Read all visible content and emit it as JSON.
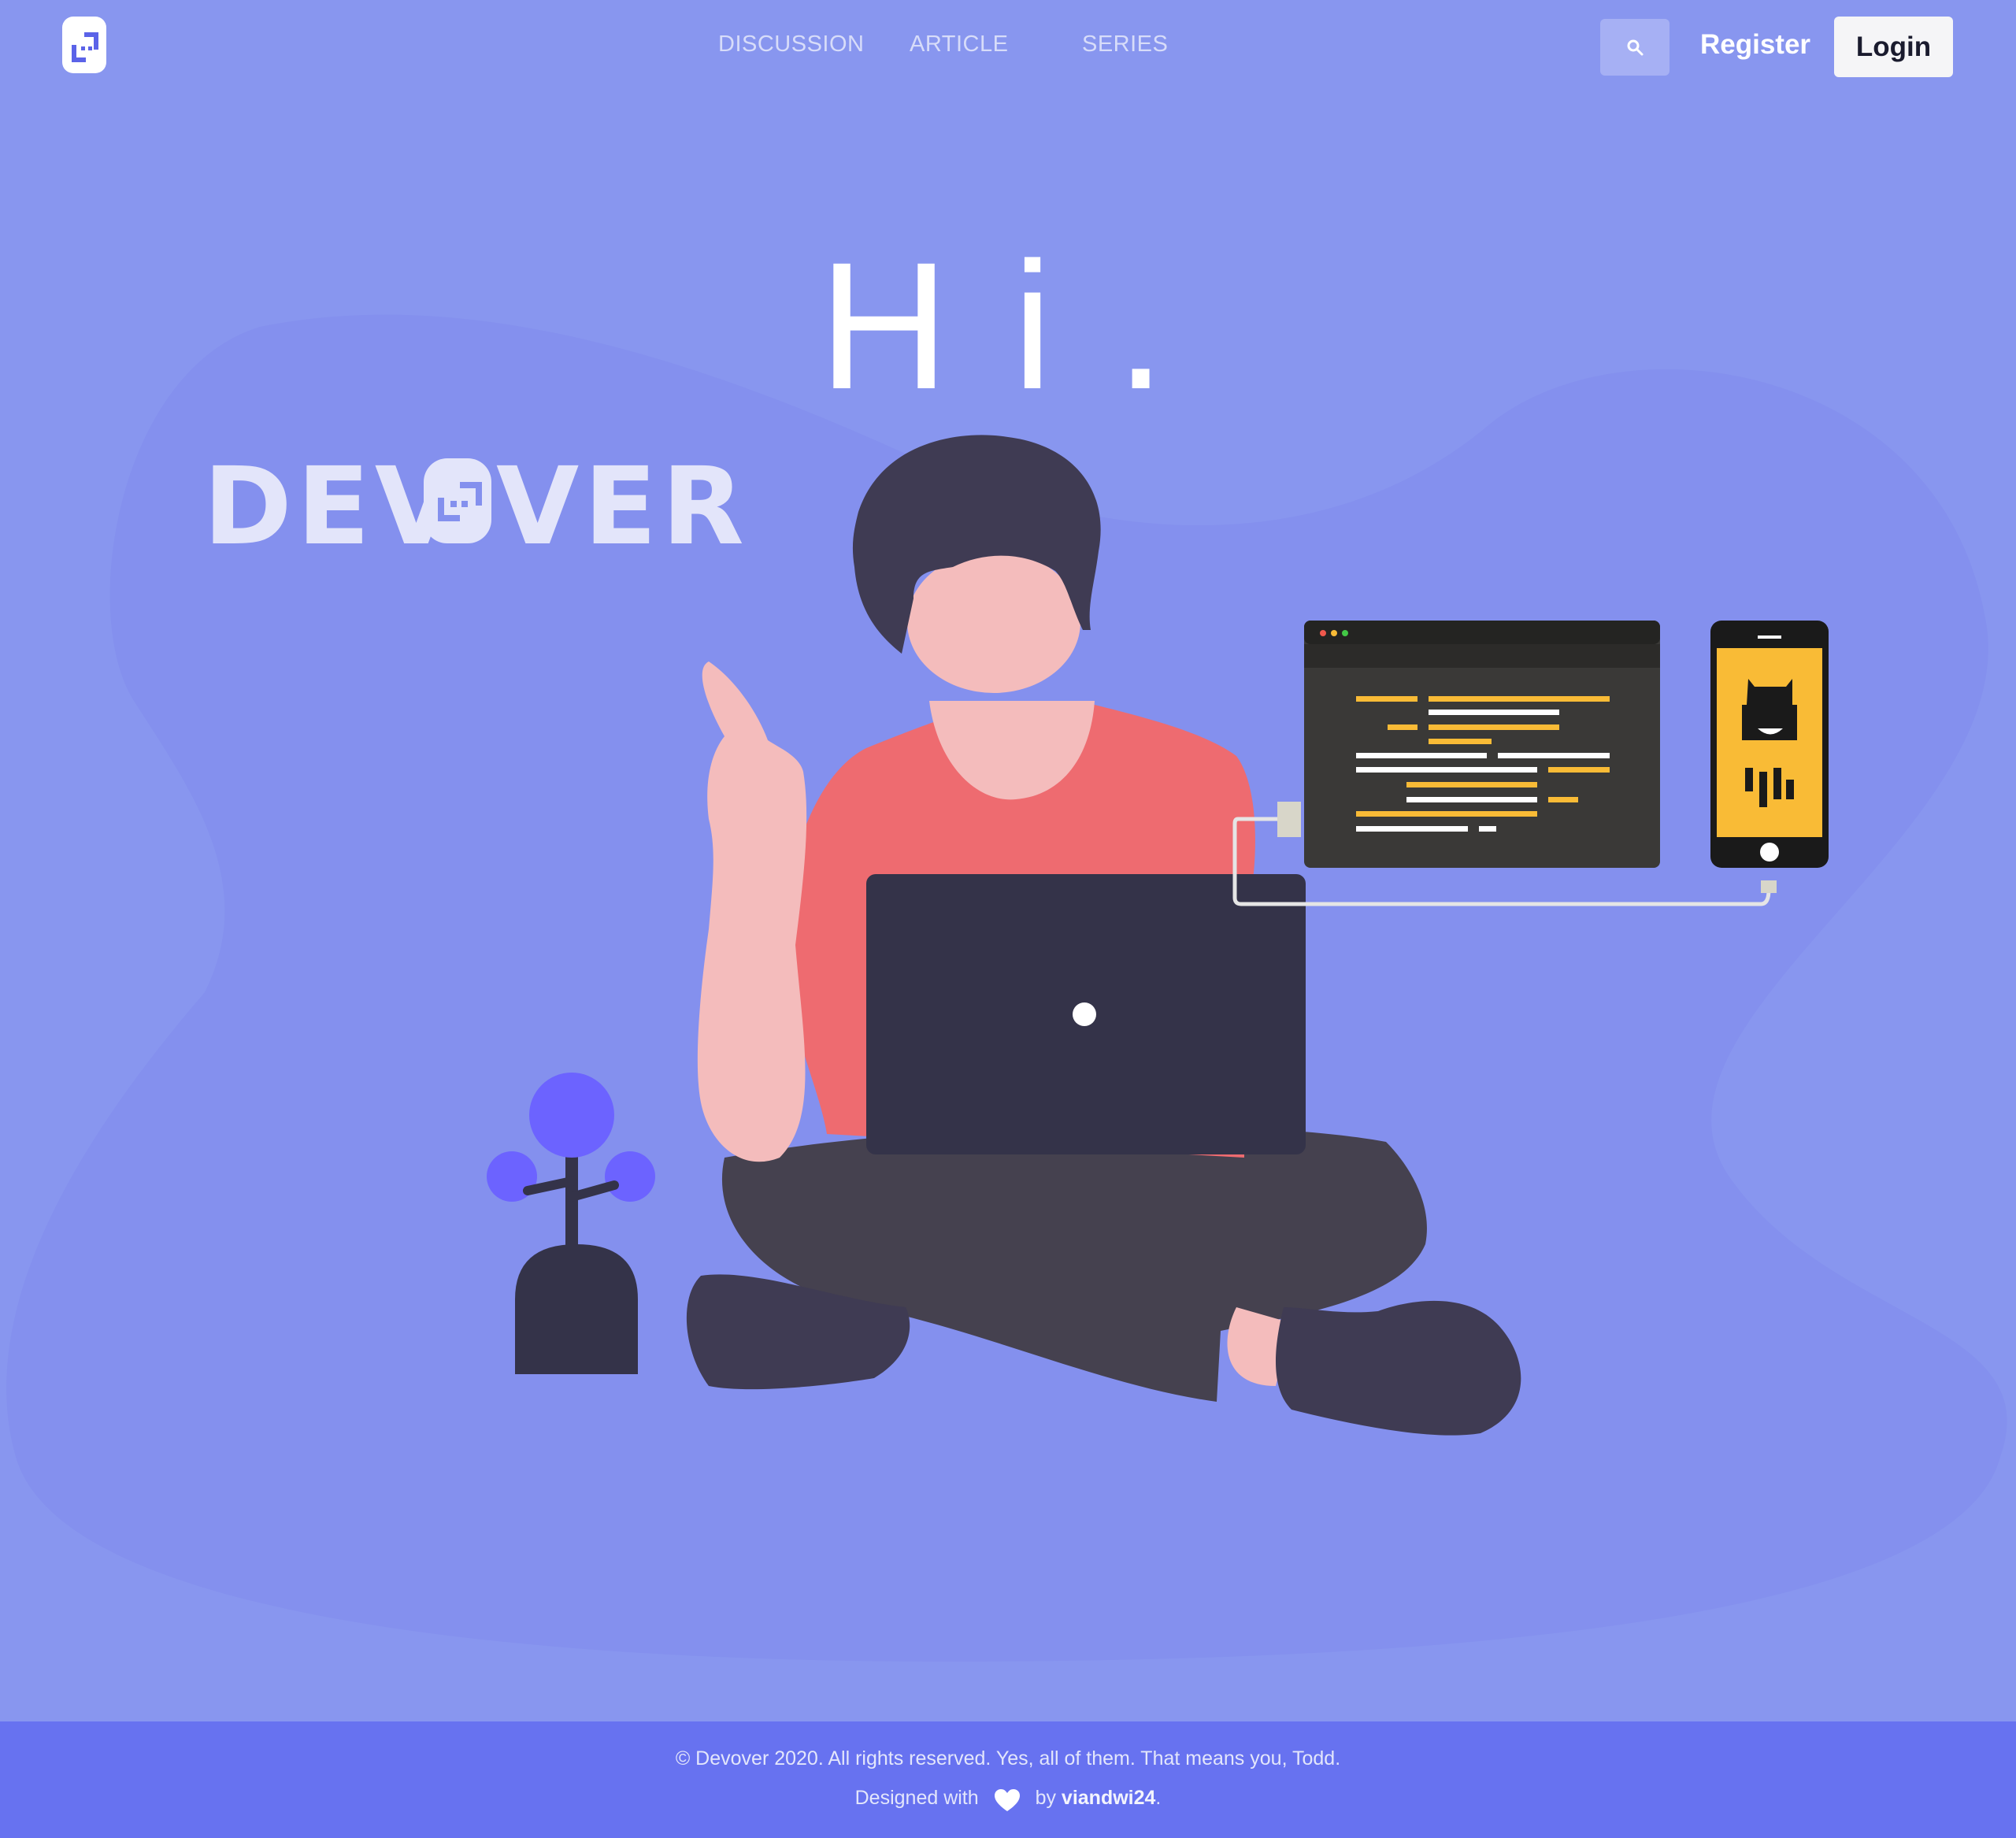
{
  "navbar": {
    "logo_icon": "devover-logo-icon",
    "links": [
      "DISCUSSION",
      "ARTICLE",
      "SERIES"
    ],
    "search_icon": "search-icon",
    "register_label": "Register",
    "login_label": "Login"
  },
  "hero": {
    "title": "Hi.",
    "brand_wordmark": "DEVOVER",
    "illustration": "developer-with-laptop-illustration"
  },
  "colors": {
    "background": "#8896ef",
    "blob": "#8490ee",
    "footer": "#6772f0",
    "accent_yellow": "#f9bb36",
    "shirt": "#ee6b70"
  },
  "footer": {
    "copyright": "© Devover 2020. All rights reserved. Yes, all of them. That means you, Todd.",
    "designed_prefix": "Designed with",
    "designed_by": "by",
    "author": "viandwi24",
    "suffix": "."
  }
}
